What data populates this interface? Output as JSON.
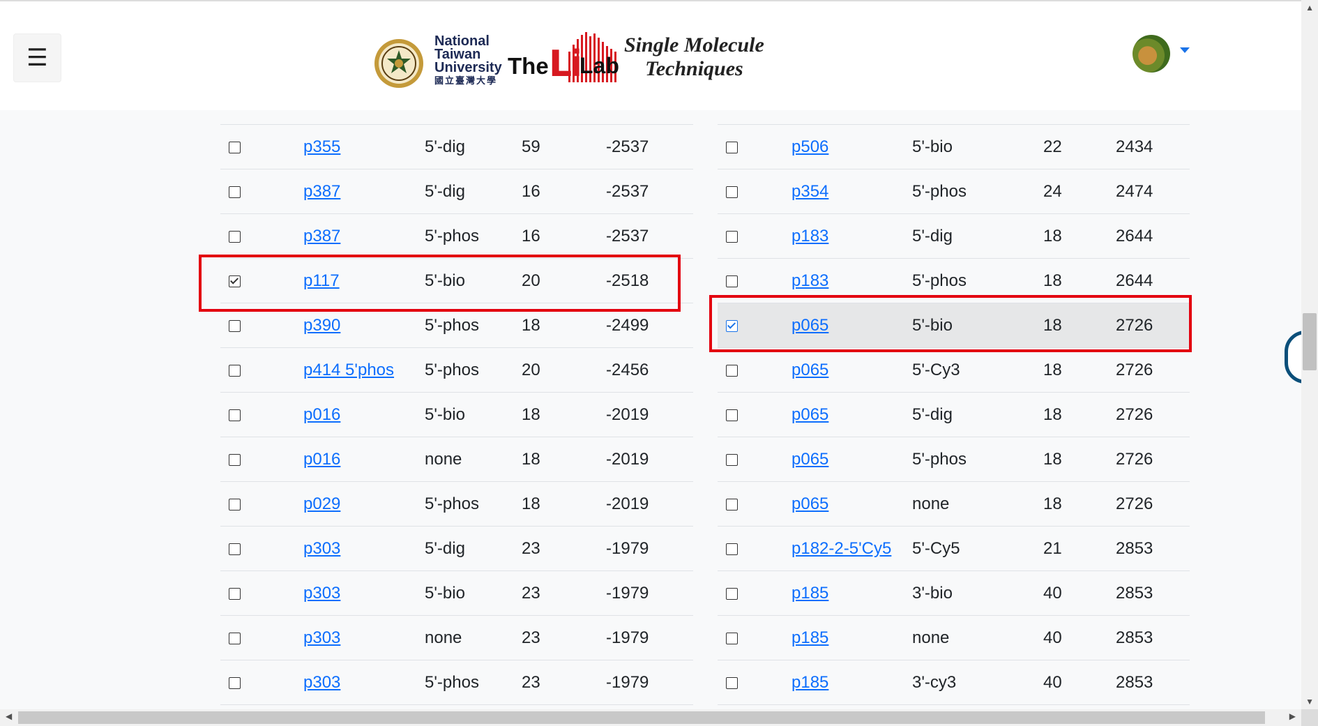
{
  "header": {
    "menu_icon": "☰",
    "logo": {
      "univ_line1": "National",
      "univ_line2": "Taiwan",
      "univ_line3": "University",
      "univ_zh": "國立臺灣大學",
      "the": "The",
      "li": "Li",
      "lab": "Lab",
      "subtitle_line1": "Single Molecule",
      "subtitle_line2": "Techniques"
    }
  },
  "left_table": {
    "rows": [
      {
        "checked": false,
        "id": "p355",
        "mod": "5'-dig",
        "len": "59",
        "pos": "-2537"
      },
      {
        "checked": false,
        "id": "p387",
        "mod": "5'-dig",
        "len": "16",
        "pos": "-2537"
      },
      {
        "checked": false,
        "id": "p387",
        "mod": "5'-phos",
        "len": "16",
        "pos": "-2537"
      },
      {
        "checked": true,
        "id": "p117",
        "mod": "5'-bio",
        "len": "20",
        "pos": "-2518"
      },
      {
        "checked": false,
        "id": "p390",
        "mod": "5'-phos",
        "len": "18",
        "pos": "-2499"
      },
      {
        "checked": false,
        "id": "p414 5'phos",
        "mod": "5'-phos",
        "len": "20",
        "pos": "-2456"
      },
      {
        "checked": false,
        "id": "p016",
        "mod": "5'-bio",
        "len": "18",
        "pos": "-2019"
      },
      {
        "checked": false,
        "id": "p016",
        "mod": "none",
        "len": "18",
        "pos": "-2019"
      },
      {
        "checked": false,
        "id": "p029",
        "mod": "5'-phos",
        "len": "18",
        "pos": "-2019"
      },
      {
        "checked": false,
        "id": "p303",
        "mod": "5'-dig",
        "len": "23",
        "pos": "-1979"
      },
      {
        "checked": false,
        "id": "p303",
        "mod": "5'-bio",
        "len": "23",
        "pos": "-1979"
      },
      {
        "checked": false,
        "id": "p303",
        "mod": "none",
        "len": "23",
        "pos": "-1979"
      },
      {
        "checked": false,
        "id": "p303",
        "mod": "5'-phos",
        "len": "23",
        "pos": "-1979"
      }
    ]
  },
  "right_table": {
    "rows": [
      {
        "checked": false,
        "id": "p506",
        "mod": "5'-bio",
        "len": "22",
        "pos": "2434"
      },
      {
        "checked": false,
        "id": "p354",
        "mod": "5'-phos",
        "len": "24",
        "pos": "2474"
      },
      {
        "checked": false,
        "id": "p183",
        "mod": "5'-dig",
        "len": "18",
        "pos": "2644"
      },
      {
        "checked": false,
        "id": "p183",
        "mod": "5'-phos",
        "len": "18",
        "pos": "2644"
      },
      {
        "checked": true,
        "id": "p065",
        "mod": "5'-bio",
        "len": "18",
        "pos": "2726"
      },
      {
        "checked": false,
        "id": "p065",
        "mod": "5'-Cy3",
        "len": "18",
        "pos": "2726"
      },
      {
        "checked": false,
        "id": "p065",
        "mod": "5'-dig",
        "len": "18",
        "pos": "2726"
      },
      {
        "checked": false,
        "id": "p065",
        "mod": "5'-phos",
        "len": "18",
        "pos": "2726"
      },
      {
        "checked": false,
        "id": "p065",
        "mod": "none",
        "len": "18",
        "pos": "2726"
      },
      {
        "checked": false,
        "id": "p182-2-5'Cy5",
        "mod": "5'-Cy5",
        "len": "21",
        "pos": "2853"
      },
      {
        "checked": false,
        "id": "p185",
        "mod": "3'-bio",
        "len": "40",
        "pos": "2853"
      },
      {
        "checked": false,
        "id": "p185",
        "mod": "none",
        "len": "40",
        "pos": "2853"
      },
      {
        "checked": false,
        "id": "p185",
        "mod": "3'-cy3",
        "len": "40",
        "pos": "2853"
      }
    ]
  },
  "colors": {
    "link": "#0d6efd",
    "highlight_box": "#e3000f",
    "highlight_row": "#e6e7e8",
    "brand_red": "#d71920"
  }
}
